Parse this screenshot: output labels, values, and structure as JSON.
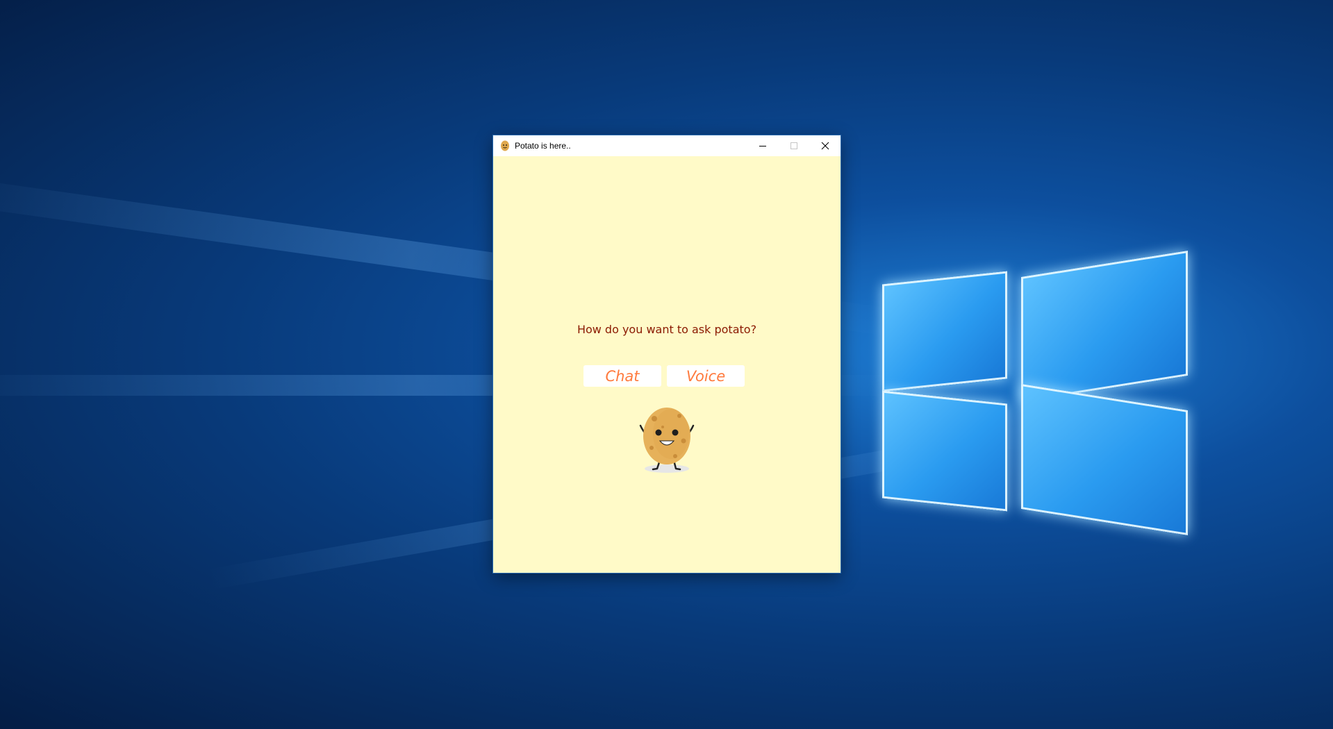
{
  "window": {
    "title": "Potato is here..",
    "controls": {
      "minimize_icon": "minimize-icon",
      "maximize_icon": "maximize-icon",
      "close_icon": "close-icon"
    }
  },
  "main": {
    "prompt": "How do you want to ask potato?",
    "buttons": {
      "chat_label": "Chat",
      "voice_label": "Voice"
    },
    "mascot_icon": "potato-mascot-icon"
  },
  "colors": {
    "window_background": "#fffac8",
    "prompt_text": "#8b1a00",
    "button_text": "#ff7a3d",
    "button_background": "#ffffff",
    "desktop_blue": "#0d4f9e"
  }
}
